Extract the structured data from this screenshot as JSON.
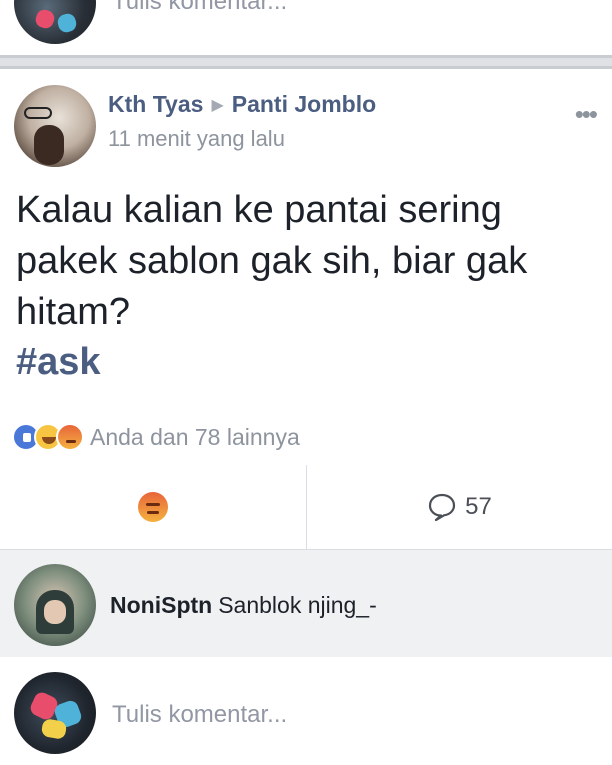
{
  "top_composer": {
    "placeholder": "Tulis komentar..."
  },
  "post": {
    "author": "Kth Tyas",
    "group": "Panti Jomblo",
    "timestamp": "11 menit yang lalu",
    "text": "Kalau kalian ke pantai sering pakek sablon gak sih, biar gak hitam?",
    "hashtag": "#ask",
    "reaction_summary": "Anda dan 78 lainnya",
    "reaction_icons": [
      "like-icon",
      "haha-icon",
      "angry-icon"
    ],
    "comment_count": "57"
  },
  "comment": {
    "author": "NoniSptn",
    "text": "Sanblok njing_-"
  },
  "bottom_composer": {
    "placeholder": "Tulis komentar..."
  },
  "colors": {
    "link_blue": "#4b5d80",
    "muted_gray": "#8d949e",
    "divider_gray": "#c9ccd1",
    "comment_bg": "#f0f1f3"
  }
}
